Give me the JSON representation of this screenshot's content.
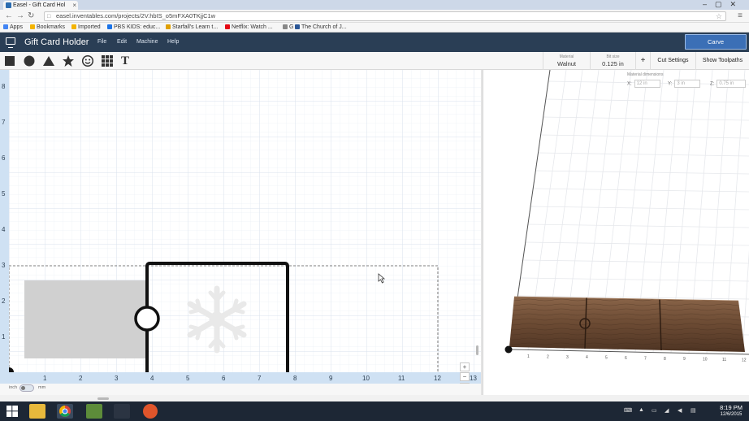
{
  "browser": {
    "tab_title": "Easel - Gift Card Hol",
    "url": "easel.inventables.com/projects/2V.hbIS_o5mFXA0TKjjC1w",
    "bookmarks": [
      {
        "label": "Apps",
        "color": "#4285f4"
      },
      {
        "label": "Bookmarks",
        "color": "#f4b400"
      },
      {
        "label": "Imported",
        "color": "#f4b400"
      },
      {
        "label": "PBS KIDS: educ...",
        "color": "#1a73e8"
      },
      {
        "label": "Starfall's Learn t...",
        "color": "#e0a000"
      },
      {
        "label": "Netflix: Watch ...",
        "color": "#e50914"
      },
      {
        "label": "G",
        "color": "#888888"
      },
      {
        "label": "The Church of J...",
        "color": "#2b5797"
      }
    ]
  },
  "app": {
    "title": "Gift Card Holder",
    "menu": [
      "File",
      "Edit",
      "Machine",
      "Help"
    ],
    "carve_label": "Carve",
    "material_label": "Material",
    "material_value": "Walnut",
    "bit_label": "Bit size",
    "bit_value": "0.125 in",
    "cut_settings": "Cut Settings",
    "show_toolpaths": "Show Toolpaths",
    "add_symbol": "+",
    "material_dimensions_label": "Material dimensions",
    "dims": {
      "x_label": "X:",
      "x_value": "12 in",
      "y_label": "Y:",
      "y_value": "3 in",
      "z_label": "Z:",
      "z_value": "0.75 in"
    }
  },
  "tools": [
    "square-tool",
    "circle-tool",
    "triangle-tool",
    "star-tool",
    "smiley-tool",
    "grid-tool",
    "text-tool"
  ],
  "text_tool_glyph": "T",
  "ruler": {
    "y_ticks": [
      "8",
      "7",
      "6",
      "5",
      "4",
      "3",
      "2",
      "1"
    ],
    "x_ticks": [
      "1",
      "2",
      "3",
      "4",
      "5",
      "6",
      "7",
      "8",
      "9",
      "10",
      "11",
      "12",
      "13"
    ]
  },
  "units": {
    "left": "inch",
    "right": "mm"
  },
  "zoom": {
    "plus": "+",
    "minus": "−",
    "home": "⌂"
  },
  "preview_ticks": [
    "1",
    "2",
    "3",
    "4",
    "5",
    "6",
    "7",
    "8",
    "9",
    "10",
    "11",
    "12"
  ],
  "clock": {
    "time": "8:19 PM",
    "date": "12/6/2015"
  },
  "colors": {
    "header": "#2a3e55",
    "carve_button": "#3b6fb6",
    "ruler": "#cfe1f3",
    "wood": "#6b4a33"
  }
}
